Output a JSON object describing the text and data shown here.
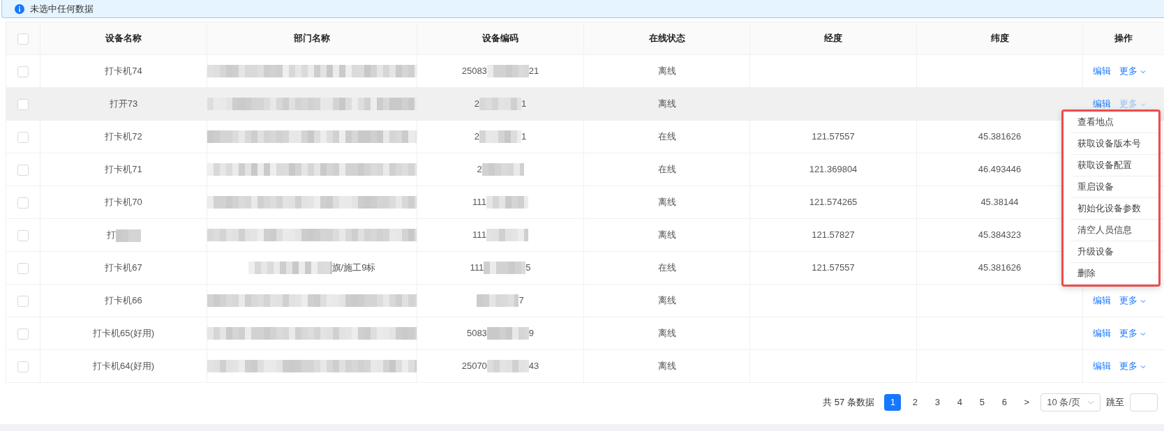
{
  "alert": {
    "text": "未选中任何数据"
  },
  "table": {
    "select_all_checked": false,
    "columns": [
      "设备名称",
      "部门名称",
      "设备编码",
      "在线状态",
      "经度",
      "纬度",
      "操作"
    ],
    "rows": [
      {
        "checked": false,
        "hovered": false,
        "name": "打卡机74",
        "code": {
          "prefix": "25083",
          "suffix": "21"
        },
        "status": "离线",
        "actions": {
          "edit": "编辑",
          "more": "更多"
        }
      },
      {
        "checked": false,
        "hovered": true,
        "name": "打开73",
        "code": {
          "prefix": "2",
          "suffix": "1"
        },
        "status": "离线",
        "actions": {
          "edit": "编辑",
          "more": "更多"
        }
      },
      {
        "checked": false,
        "hovered": false,
        "name": "打卡机72",
        "code": {
          "prefix": "2",
          "suffix": "1"
        },
        "status": "在线",
        "lng": "121.57557",
        "lat": "45.381626"
      },
      {
        "checked": false,
        "hovered": false,
        "name": "打卡机71",
        "code": {
          "prefix": "2"
        },
        "status": "在线",
        "lng": "121.369804",
        "lat": "46.493446"
      },
      {
        "checked": false,
        "hovered": false,
        "name": "打卡机70",
        "code": {
          "prefix": "111"
        },
        "status": "离线",
        "lng": "121.574265",
        "lat": "45.38144"
      },
      {
        "checked": false,
        "hovered": false,
        "name": "打",
        "code": {
          "prefix": "111"
        },
        "status": "离线",
        "lng": "121.57827",
        "lat": "45.384323"
      },
      {
        "checked": false,
        "hovered": false,
        "name": "打卡机67",
        "dept": "旗/施工9标",
        "code": {
          "prefix": "111",
          "suffix": "5"
        },
        "status": "在线",
        "lng": "121.57557",
        "lat": "45.381626"
      },
      {
        "checked": false,
        "hovered": false,
        "name": "打卡机66",
        "code": {
          "suffix": "7"
        },
        "status": "离线",
        "actions": {
          "edit": "编辑",
          "more": "更多"
        }
      },
      {
        "checked": false,
        "hovered": false,
        "name": "打卡机65(好用)",
        "code": {
          "prefix": "5083",
          "suffix": "9"
        },
        "status": "离线",
        "actions": {
          "edit": "编辑",
          "more": "更多"
        }
      },
      {
        "checked": false,
        "hovered": false,
        "name": "打卡机64(好用)",
        "code": {
          "prefix": "25070",
          "suffix": "43"
        },
        "status": "离线",
        "actions": {
          "edit": "编辑",
          "more": "更多"
        }
      }
    ]
  },
  "dropdown": {
    "highlighted": true,
    "items": [
      "查看地点",
      "获取设备版本号",
      "获取设备配置",
      "重启设备",
      "初始化设备参数",
      "清空人员信息",
      "升级设备",
      "删除"
    ]
  },
  "pagination": {
    "total": "共 57 条数据",
    "pages": [
      {
        "label": "1",
        "selected": true
      },
      {
        "label": "2",
        "selected": false
      },
      {
        "label": "3",
        "selected": false
      },
      {
        "label": "4",
        "selected": false
      },
      {
        "label": "5",
        "selected": false
      },
      {
        "label": "6",
        "selected": false
      }
    ],
    "next": ">",
    "page_size": "10 条/页",
    "jump_label": "跳至"
  }
}
